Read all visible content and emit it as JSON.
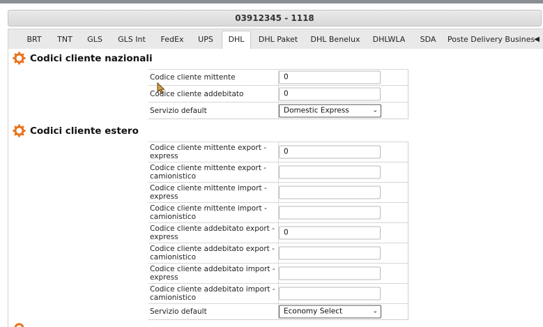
{
  "header": {
    "title": "03912345 - 1118"
  },
  "tabs": [
    {
      "label": "BRT"
    },
    {
      "label": "TNT"
    },
    {
      "label": "GLS"
    },
    {
      "label": "GLS Int"
    },
    {
      "label": "FedEx"
    },
    {
      "label": "UPS"
    },
    {
      "label": "DHL",
      "active": true
    },
    {
      "label": "DHL Paket"
    },
    {
      "label": "DHL Benelux"
    },
    {
      "label": "DHLWLA"
    },
    {
      "label": "SDA"
    },
    {
      "label": "Poste Delivery Busines"
    }
  ],
  "tab_scroll_icon": "caret-left-icon",
  "section_icon": "gear-icon",
  "accent_color": "#e8731c",
  "sections": {
    "national": {
      "title": "Codici cliente nazionali",
      "rows": [
        {
          "label": "Codice cliente mittente",
          "value": "0"
        },
        {
          "label": "Codice cliente addebitato",
          "value": "0"
        },
        {
          "label": "Servizio default",
          "selected": "Domestic Express"
        }
      ]
    },
    "foreign": {
      "title": "Codici cliente estero",
      "rows": [
        {
          "label": "Codice cliente mittente export - express",
          "value": "0"
        },
        {
          "label": "Codice cliente mittente export - camionistico",
          "value": ""
        },
        {
          "label": "Codice cliente mittente import - express",
          "value": ""
        },
        {
          "label": "Codice cliente mittente import - camionistico",
          "value": ""
        },
        {
          "label": "Codice cliente addebitato export - express",
          "value": "0"
        },
        {
          "label": "Codice cliente addebitato export - camionistico",
          "value": ""
        },
        {
          "label": "Codice cliente addebitato import - express",
          "value": ""
        },
        {
          "label": "Codice cliente addebitato import - camionistico",
          "value": ""
        },
        {
          "label": "Servizio default",
          "selected": "Economy Select"
        }
      ]
    }
  }
}
